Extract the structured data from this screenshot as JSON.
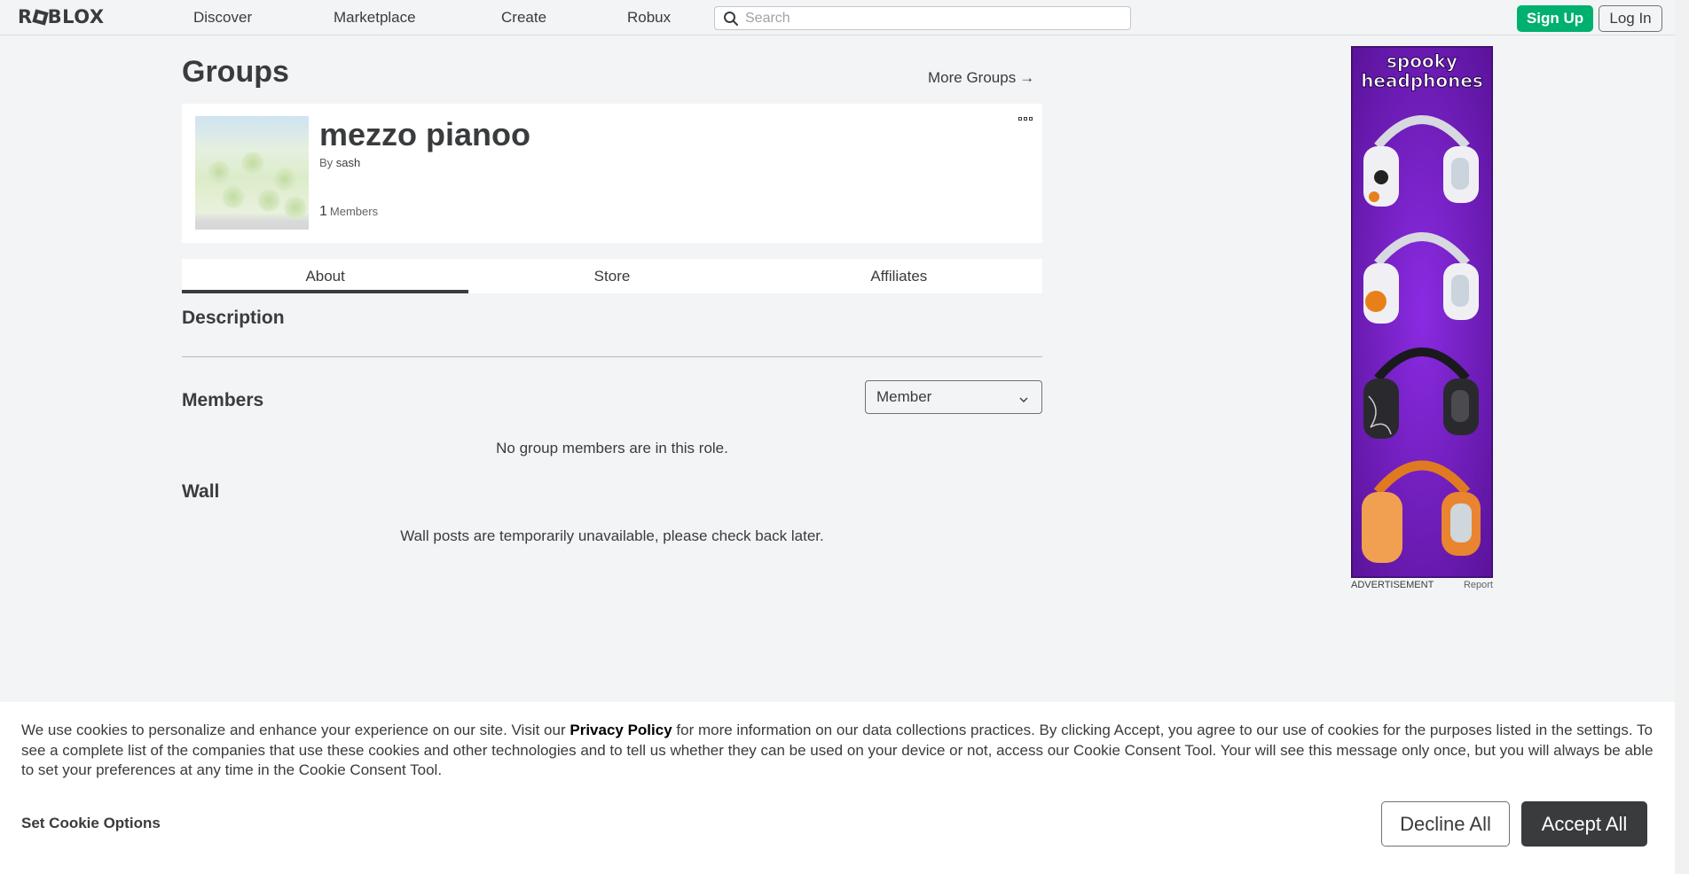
{
  "nav": {
    "logo": "ROBLOX",
    "links": [
      "Discover",
      "Marketplace",
      "Create",
      "Robux"
    ],
    "search_placeholder": "Search",
    "signup": "Sign Up",
    "login": "Log In"
  },
  "page": {
    "title": "Groups",
    "more_groups": "More Groups",
    "more_groups_arrow": "→"
  },
  "group": {
    "name": "mezzo pianoo",
    "by_label": "By",
    "owner": "sash",
    "member_count": "1",
    "members_label": "Members"
  },
  "tabs": [
    "About",
    "Store",
    "Affiliates"
  ],
  "active_tab": "About",
  "sections": {
    "description": "Description",
    "members": "Members",
    "role_selected": "Member",
    "members_empty": "No group members are in this role.",
    "wall": "Wall",
    "wall_msg": "Wall posts are temporarily unavailable, please check back later."
  },
  "ad": {
    "headline_line1": "spooky",
    "headline_line2": "headphones",
    "label": "ADVERTISEMENT",
    "report": "Report"
  },
  "cookie": {
    "text_before": "We use cookies to personalize and enhance your experience on our site. Visit our ",
    "privacy_link": "Privacy Policy",
    "text_after": " for more information on our data collections practices. By clicking Accept, you agree to our use of cookies for the purposes listed in the settings. To see a complete list of the companies that use these cookies and other technologies and to tell us whether they can be used on your device or not, access our Cookie Consent Tool. Your will see this message only once, but you will always be able to set your preferences at any time in the Cookie Consent Tool.",
    "set_options": "Set Cookie Options",
    "decline": "Decline All",
    "accept": "Accept All"
  },
  "colors": {
    "signup_green": "#00b06f",
    "text_dark": "#393b3d",
    "page_bg": "#f2f4f5",
    "ad_purple": "#6a1bb0"
  }
}
